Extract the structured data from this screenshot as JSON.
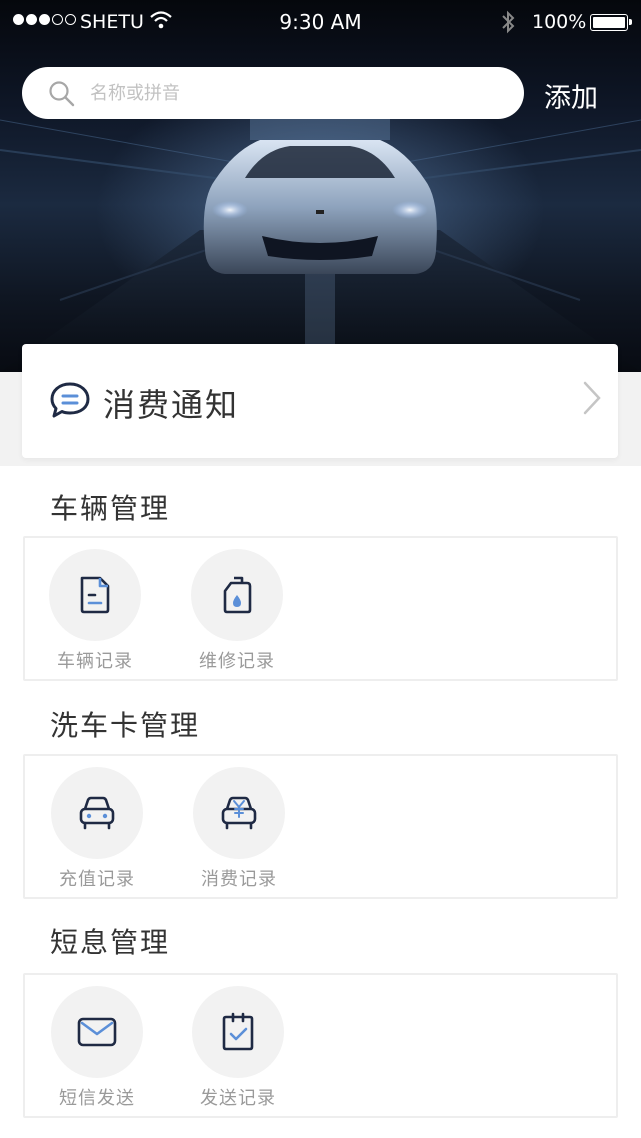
{
  "status_bar": {
    "carrier": "SHETU",
    "time": "9:30 AM",
    "battery": "100%"
  },
  "search": {
    "placeholder": "名称或拼音",
    "add_label": "添加"
  },
  "notice": {
    "title": "消费通知"
  },
  "sections": [
    {
      "title": "车辆管理",
      "items": [
        {
          "label": "车辆记录",
          "icon": "document-icon"
        },
        {
          "label": "维修记录",
          "icon": "oil-can-icon"
        }
      ]
    },
    {
      "title": "洗车卡管理",
      "items": [
        {
          "label": "充值记录",
          "icon": "car-icon"
        },
        {
          "label": "消费记录",
          "icon": "car-yen-icon"
        }
      ]
    },
    {
      "title": "短息管理",
      "items": [
        {
          "label": "短信发送",
          "icon": "envelope-icon"
        },
        {
          "label": "发送记录",
          "icon": "checklist-icon"
        }
      ]
    }
  ],
  "colors": {
    "icon_dark": "#1f2a44",
    "icon_accent": "#5b8fd8",
    "label_gray": "#9a9a9a"
  }
}
